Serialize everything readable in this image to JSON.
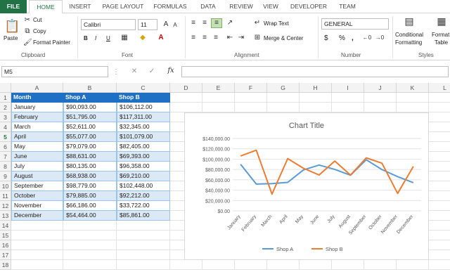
{
  "tabs": [
    "FILE",
    "HOME",
    "INSERT",
    "PAGE LAYOUT",
    "FORMULAS",
    "DATA",
    "REVIEW",
    "VIEW",
    "DEVELOPER",
    "TEAM"
  ],
  "ribbon": {
    "clipboard": {
      "paste": "Paste",
      "cut": "Cut",
      "copy": "Copy",
      "format_painter": "Format Painter",
      "label": "Clipboard"
    },
    "font": {
      "name": "Calibri",
      "size": "11",
      "label": "Font",
      "bold": "B",
      "italic": "I",
      "underline": "U"
    },
    "alignment": {
      "wrap": "Wrap Text",
      "merge": "Merge & Center",
      "label": "Alignment"
    },
    "number": {
      "format": "GENERAL",
      "label": "Number",
      "currency": "$",
      "percent": "%",
      "comma": ","
    },
    "styles": {
      "cond1": "Conditional",
      "cond2": "Formatting",
      "table1": "Format",
      "table2": "Table",
      "label": "Styles"
    }
  },
  "formula_bar": {
    "name_box": "M5",
    "fx": "fx",
    "content": ""
  },
  "columns": [
    "A",
    "B",
    "C",
    "D",
    "E",
    "F",
    "G",
    "H",
    "I",
    "J",
    "K",
    "L"
  ],
  "rows": [
    "1",
    "2",
    "3",
    "4",
    "5",
    "6",
    "7",
    "8",
    "9",
    "10",
    "11",
    "12",
    "13",
    "14",
    "15",
    "16",
    "17",
    "18"
  ],
  "table": {
    "headers": [
      "Month",
      "Shop A",
      "Shop B"
    ],
    "rows": [
      [
        "January",
        "$90,093.00",
        "$106,112.00"
      ],
      [
        "February",
        "$51,795.00",
        "$117,311.00"
      ],
      [
        "March",
        "$52,611.00",
        "$32,345.00"
      ],
      [
        "April",
        "$55,077.00",
        "$101,079.00"
      ],
      [
        "May",
        "$79,079.00",
        "$82,405.00"
      ],
      [
        "June",
        "$88,631.00",
        "$69,393.00"
      ],
      [
        "July",
        "$80,135.00",
        "$96,358.00"
      ],
      [
        "August",
        "$68,938.00",
        "$69,210.00"
      ],
      [
        "September",
        "$98,779.00",
        "$102,448.00"
      ],
      [
        "October",
        "$79,885.00",
        "$92,212.00"
      ],
      [
        "November",
        "$66,186.00",
        "$33,722.00"
      ],
      [
        "December",
        "$54,464.00",
        "$85,861.00"
      ]
    ]
  },
  "chart_data": {
    "type": "line",
    "title": "Chart Title",
    "categories": [
      "January",
      "February",
      "March",
      "April",
      "May",
      "June",
      "July",
      "August",
      "September",
      "October",
      "November",
      "December"
    ],
    "series": [
      {
        "name": "Shop A",
        "color": "#5b9bd5",
        "values": [
          90093,
          51795,
          52611,
          55077,
          79079,
          88631,
          80135,
          68938,
          98779,
          79885,
          66186,
          54464
        ]
      },
      {
        "name": "Shop B",
        "color": "#ed7d31",
        "values": [
          106112,
          117311,
          32345,
          101079,
          82405,
          69393,
          96358,
          69210,
          102448,
          92212,
          33722,
          85861
        ]
      }
    ],
    "yticks": [
      "$0.00",
      "$20,000.00",
      "$40,000.00",
      "$60,000.00",
      "$80,000.00",
      "$100,000.00",
      "$120,000.00",
      "$140,000.00"
    ],
    "ylim": [
      0,
      140000
    ],
    "grid": true,
    "legend": "bottom"
  }
}
